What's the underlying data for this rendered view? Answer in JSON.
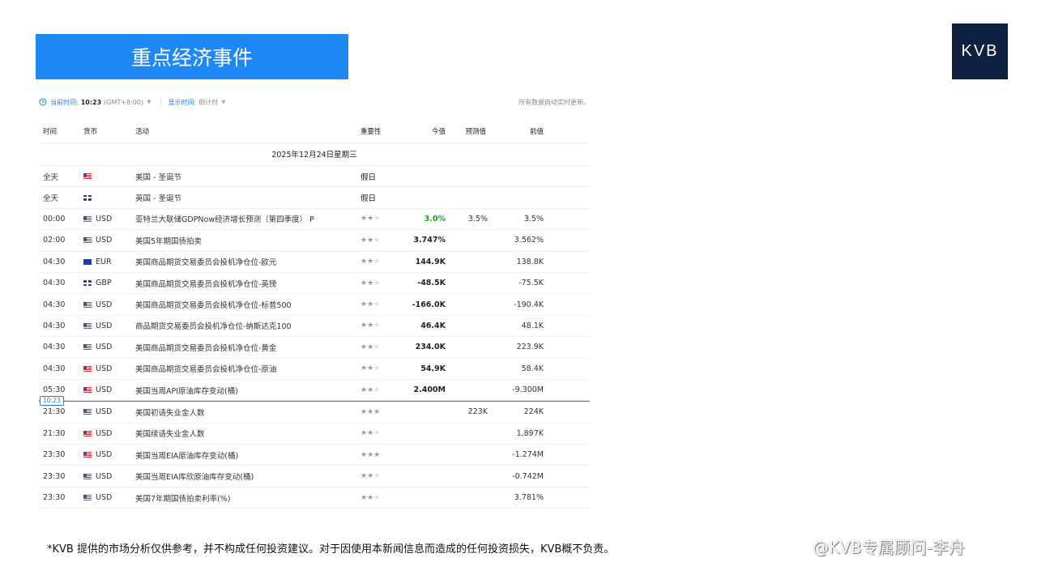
{
  "banner": {
    "title": "重点经济事件"
  },
  "logo": {
    "text": "KVB"
  },
  "topbar": {
    "current_time_label": "当前时间:",
    "current_time": "10:23",
    "timezone": "(GMT+8:00)",
    "display_label": "显示时间:",
    "display_value": "倒计时",
    "auto_update": "所有数据自动实时更新。"
  },
  "table": {
    "headers": {
      "time": "时间",
      "currency": "货币",
      "event": "活动",
      "importance": "重要性",
      "actual": "今值",
      "forecast": "预测值",
      "previous": "前值"
    },
    "date": "2025年12月24日星期三",
    "now_badge": "10:23",
    "rows": [
      {
        "time": "全天",
        "flag": "us",
        "currency": "",
        "event": "美国 - 圣诞节",
        "holiday": "假日"
      },
      {
        "time": "全天",
        "flag": "gb",
        "currency": "",
        "event": "英国 - 圣诞节",
        "holiday": "假日"
      },
      {
        "time": "00:00",
        "flag": "us",
        "currency": "USD",
        "event": "亚特兰大联储GDPNow经济增长预测（第四季度）  P",
        "stars": 2,
        "actual": "3.0%",
        "actual_color": "green",
        "forecast": "3.5%",
        "previous": "3.5%"
      },
      {
        "time": "02:00",
        "flag": "us",
        "currency": "USD",
        "event": "美国5年期国债拍卖",
        "stars": 2,
        "actual": "3.747%",
        "forecast": "",
        "previous": "3.562%"
      },
      {
        "time": "04:30",
        "flag": "eu",
        "currency": "EUR",
        "event": "美国商品期货交易委员会投机净仓位-欧元",
        "stars": 2,
        "actual": "144.9K",
        "forecast": "",
        "previous": "138.8K"
      },
      {
        "time": "04:30",
        "flag": "gb",
        "currency": "GBP",
        "event": "美国商品期货交易委员会投机净仓位-英镑",
        "stars": 2,
        "actual": "-48.5K",
        "forecast": "",
        "previous": "-75.5K"
      },
      {
        "time": "04:30",
        "flag": "us",
        "currency": "USD",
        "event": "美国商品期货交易委员会投机净仓位-标普500",
        "stars": 2,
        "actual": "-166.0K",
        "forecast": "",
        "previous": "-190.4K"
      },
      {
        "time": "04:30",
        "flag": "us",
        "currency": "USD",
        "event": "商品期货交易委员会投机净仓位-纳斯达克100",
        "stars": 2,
        "actual": "46.4K",
        "forecast": "",
        "previous": "48.1K"
      },
      {
        "time": "04:30",
        "flag": "us",
        "currency": "USD",
        "event": "美国商品期货交易委员会投机净仓位-黄金",
        "stars": 2,
        "actual": "234.0K",
        "forecast": "",
        "previous": "223.9K"
      },
      {
        "time": "04:30",
        "flag": "us",
        "currency": "USD",
        "event": "美国商品期货交易委员会投机净仓位-原油",
        "stars": 2,
        "actual": "54.9K",
        "forecast": "",
        "previous": "58.4K"
      },
      {
        "time": "05:30",
        "flag": "us",
        "currency": "USD",
        "event": "美国当周API原油库存变动(桶)",
        "stars": 2,
        "actual": "2.400M",
        "forecast": "",
        "previous": "-9.300M"
      },
      {
        "time": "21:30",
        "flag": "us",
        "currency": "USD",
        "event": "美国初请失业金人数",
        "stars": 3,
        "actual": "",
        "forecast": "223K",
        "previous": "224K"
      },
      {
        "time": "21:30",
        "flag": "us",
        "currency": "USD",
        "event": "美国续请失业金人数",
        "stars": 2,
        "actual": "",
        "forecast": "",
        "previous": "1,897K"
      },
      {
        "time": "23:30",
        "flag": "us",
        "currency": "USD",
        "event": "美国当周EIA原油库存变动(桶)",
        "stars": 3,
        "actual": "",
        "forecast": "",
        "previous": "-1.274M"
      },
      {
        "time": "23:30",
        "flag": "us",
        "currency": "USD",
        "event": "美国当周EIA库欣原油库存变动(桶)",
        "stars": 2,
        "actual": "",
        "forecast": "",
        "previous": "-0.742M"
      },
      {
        "time": "23:30",
        "flag": "us",
        "currency": "USD",
        "event": "美国7年期国债拍卖利率(%)",
        "stars": 2,
        "actual": "",
        "forecast": "",
        "previous": "3.781%"
      }
    ]
  },
  "colors": {
    "accent": "#1e88f5",
    "logo_bg": "#0f2140",
    "positive": "#1aa31a",
    "now_line": "#2a7fd4"
  },
  "footer": {
    "disclaimer": "*KVB 提供的市场分析仅供参考，并不构成任何投资建议。对于因使用本新闻信息而造成的任何投资损失，KVB概不负责。",
    "watermark": "@KVB专属顾问-李舟"
  }
}
